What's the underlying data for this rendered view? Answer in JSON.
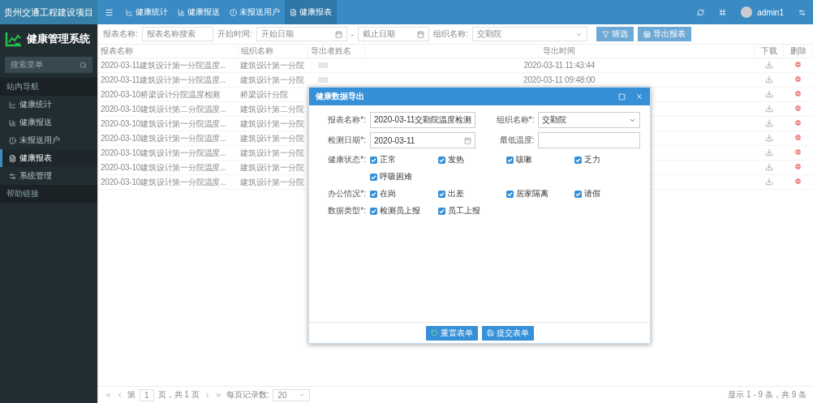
{
  "brand": "贵州交通工程建设项目",
  "topnav": {
    "items": [
      {
        "label": "健康统计",
        "selected": false
      },
      {
        "label": "健康报送",
        "selected": false
      },
      {
        "label": "未报送用户",
        "selected": false
      },
      {
        "label": "健康报表",
        "selected": true
      }
    ],
    "user": "admin1"
  },
  "sidebar": {
    "title": "健康管理系统",
    "search_placeholder": "搜索菜单",
    "sections": [
      {
        "header": "站内导航",
        "items": [
          {
            "label": "健康统计",
            "selected": false
          },
          {
            "label": "健康报送",
            "selected": false
          },
          {
            "label": "未报送用户",
            "selected": false
          },
          {
            "label": "健康报表",
            "selected": true
          },
          {
            "label": "系统管理",
            "selected": false
          }
        ]
      },
      {
        "header": "帮助链接"
      }
    ]
  },
  "filters": {
    "name_label": "报表名称:",
    "name_placeholder": "报表名称搜索",
    "time_label": "开始时间:",
    "start_placeholder": "开始日期",
    "separator": "-",
    "end_placeholder": "截止日期",
    "org_label": "组织名称:",
    "org_value": "交勤院",
    "buttons": [
      "筛选",
      "导出报表"
    ]
  },
  "table": {
    "columns": [
      "报表名称",
      "组织名称",
      "导出者姓名",
      "导出时间",
      "下载",
      "删除"
    ],
    "rows": [
      {
        "name": "2020-03-11建筑设计第一分院温度...",
        "org": "建筑设计第一分院",
        "time": "2020-03-11 11:43:44"
      },
      {
        "name": "2020-03-11建筑设计第一分院温度...",
        "org": "建筑设计第一分院",
        "time": "2020-03-11 09:48:00"
      },
      {
        "name": "2020-03-10桥梁设计分院温度检测",
        "org": "桥梁设计分院"
      },
      {
        "name": "2020-03-10建筑设计第二分院温度...",
        "org": "建筑设计第二分院"
      },
      {
        "name": "2020-03-10建筑设计第一分院温度...",
        "org": "建筑设计第一分院"
      },
      {
        "name": "2020-03-10建筑设计第一分院温度...",
        "org": "建筑设计第一分院"
      },
      {
        "name": "2020-03-10建筑设计第一分院温度...",
        "org": "建筑设计第一分院"
      },
      {
        "name": "2020-03-10建筑设计第一分院温度...",
        "org": "建筑设计第一分院"
      },
      {
        "name": "2020-03-10建筑设计第一分院温度...",
        "org": "建筑设计第一分院"
      }
    ]
  },
  "pagination": {
    "page_prefix": "第",
    "page": "1",
    "page_suffix": "页，共 1 页",
    "per_page_label": "每页记录数:",
    "per_page": "20",
    "summary": "显示 1 - 9 条，共 9 条"
  },
  "dialog": {
    "title": "健康数据导出",
    "fields": [
      {
        "label": "报表名称*:",
        "kind": "text",
        "value": "2020-03-11交勤院温度检测"
      },
      {
        "label": "组织名称*:",
        "kind": "select",
        "value": "交勤院"
      },
      {
        "label": "检测日期*:",
        "kind": "date",
        "value": "2020-03-11"
      },
      {
        "label": "最低温度:",
        "kind": "text"
      }
    ],
    "groups": [
      {
        "label": "健康状态*:",
        "options": [
          {
            "label": "正常",
            "checked": true
          },
          {
            "label": "发热",
            "checked": true
          },
          {
            "label": "咳嗽",
            "checked": true
          },
          {
            "label": "乏力",
            "checked": true
          },
          {
            "label": "呼吸困难",
            "checked": true
          }
        ]
      },
      {
        "label": "办公情况*:",
        "options": [
          {
            "label": "在岗",
            "checked": true
          },
          {
            "label": "出差",
            "checked": true
          },
          {
            "label": "居家隔离",
            "checked": true
          },
          {
            "label": "请假",
            "checked": true
          }
        ]
      },
      {
        "label": "数据类型*:",
        "options": [
          {
            "label": "检测员上报",
            "checked": true
          },
          {
            "label": "员工上报",
            "checked": true
          }
        ]
      }
    ],
    "buttons": [
      {
        "label": "重置表单",
        "kind": "reset"
      },
      {
        "label": "提交表单",
        "kind": "submit"
      }
    ]
  }
}
